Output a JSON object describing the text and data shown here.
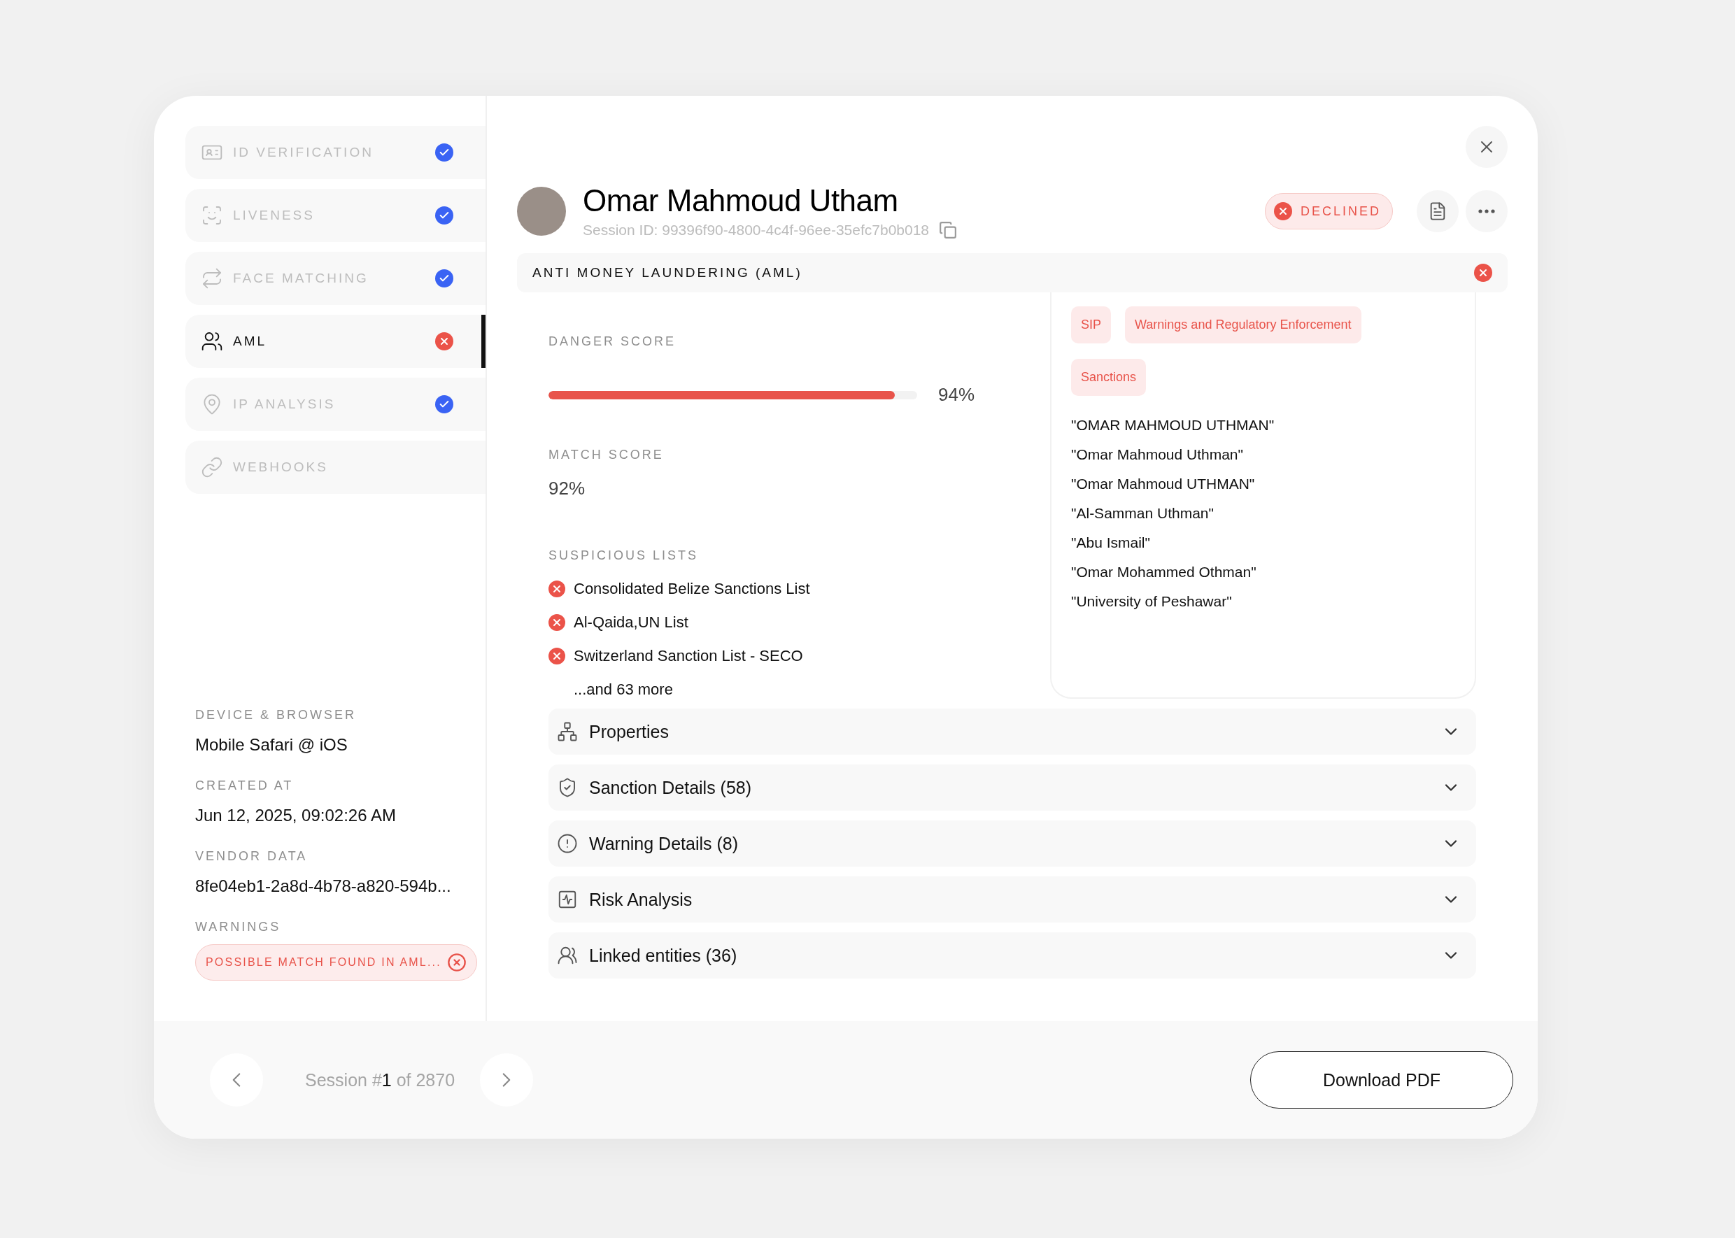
{
  "sidebar": {
    "items": [
      {
        "label": "ID VERIFICATION",
        "passed": true,
        "selected": false
      },
      {
        "label": "LIVENESS",
        "passed": true,
        "selected": false
      },
      {
        "label": "FACE MATCHING",
        "passed": true,
        "selected": false
      },
      {
        "label": "AML",
        "passed": false,
        "selected": true
      },
      {
        "label": "IP ANALYSIS",
        "passed": true,
        "selected": false
      },
      {
        "label": "WEBHOOKS",
        "selected": false
      }
    ],
    "details": [
      {
        "label": "DEVICE & BROWSER",
        "value": "Mobile Safari @ iOS"
      },
      {
        "label": "CREATED AT",
        "value": "Jun 12, 2025, 09:02:26 AM"
      },
      {
        "label": "VENDOR DATA",
        "value": "8fe04eb1-2a8d-4b78-a820-594b..."
      }
    ],
    "warnings": {
      "label": "WARNINGS",
      "items": [
        "POSSIBLE MATCH FOUND IN AML..."
      ]
    }
  },
  "header": {
    "name": "Omar Mahmoud Utham",
    "session_id": "Session ID: 99396f90-4800-4c4f-96ee-35efc7b0b018",
    "status": {
      "label": "DECLINED",
      "kind": "declined"
    }
  },
  "section": {
    "title": "ANTI MONEY LAUNDERING (AML)",
    "passed": false
  },
  "danger_score": {
    "label": "DANGER SCORE",
    "level": 0.94,
    "reading": "94%"
  },
  "match_score": {
    "label": "MATCH SCORE",
    "value": "92%"
  },
  "suspicious_lists": {
    "label": "SUSPICIOUS LISTS",
    "items": [
      "Consolidated Belize Sanctions List",
      "Al-Qaida,UN List",
      "Switzerland Sanction List - SECO"
    ],
    "more": "...and 63 more"
  },
  "categories": [
    "SIP",
    "Warnings and Regulatory Enforcement",
    "Sanctions"
  ],
  "aliases": [
    "\"OMAR MAHMOUD UTHMAN\"",
    "\"Omar Mahmoud Uthman\"",
    "\"Omar Mahmoud UTHMAN\"",
    "\"Al-Samman Uthman\"",
    "\"Abu Ismail\"",
    "\"Omar Mohammed Othman\"",
    "\"University of Peshawar\""
  ],
  "accordions": [
    {
      "label": "Properties",
      "expanded": false
    },
    {
      "label": "Sanction Details (58)",
      "expanded": false
    },
    {
      "label": "Warning Details (8)",
      "expanded": false
    },
    {
      "label": "Risk Analysis",
      "expanded": false
    },
    {
      "label": "Linked entities (36)",
      "expanded": false
    }
  ],
  "footer": {
    "session": "Session #**1** of 2870",
    "download": "Download PDF"
  }
}
